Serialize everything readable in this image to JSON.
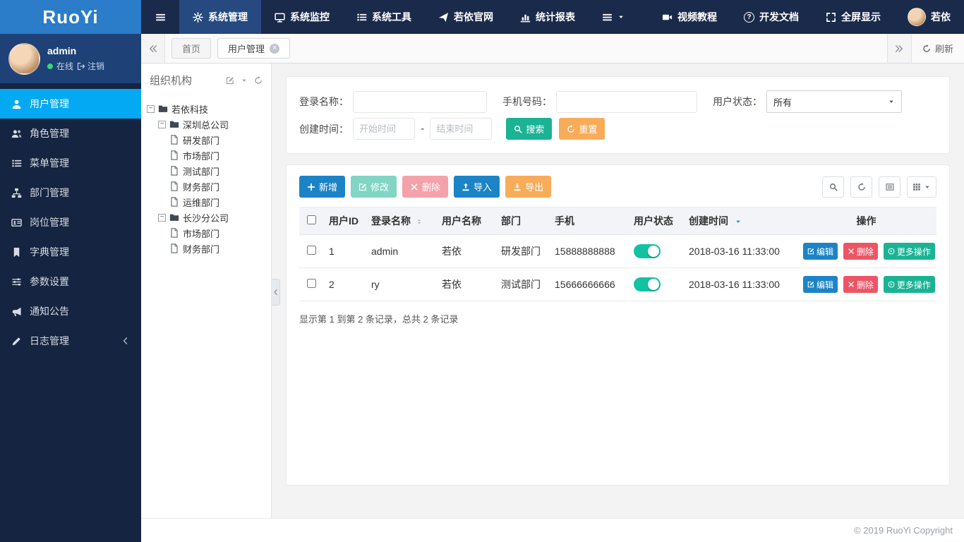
{
  "brand": {
    "logo_text": "RuoYi"
  },
  "topnav": {
    "items": [
      {
        "label": "系统管理",
        "icon": "gear-icon",
        "active": true
      },
      {
        "label": "系统监控",
        "icon": "monitor-icon",
        "active": false
      },
      {
        "label": "系统工具",
        "icon": "list-icon",
        "active": false
      },
      {
        "label": "若依官网",
        "icon": "send-icon",
        "active": false
      },
      {
        "label": "统计报表",
        "icon": "bar-chart-icon",
        "active": false
      }
    ],
    "right_items": [
      {
        "label": "视频教程",
        "icon": "video-icon"
      },
      {
        "label": "开发文档",
        "icon": "question-circle-icon"
      },
      {
        "label": "全屏显示",
        "icon": "expand-icon"
      }
    ],
    "user_name": "若依"
  },
  "sidebar": {
    "user": {
      "name": "admin",
      "status": "在线",
      "logout_label": "注销"
    },
    "items": [
      {
        "label": "用户管理",
        "icon": "user-icon",
        "active": true
      },
      {
        "label": "角色管理",
        "icon": "users-icon",
        "active": false
      },
      {
        "label": "菜单管理",
        "icon": "menu-list-icon",
        "active": false
      },
      {
        "label": "部门管理",
        "icon": "sitemap-icon",
        "active": false
      },
      {
        "label": "岗位管理",
        "icon": "id-card-icon",
        "active": false
      },
      {
        "label": "字典管理",
        "icon": "bookmark-icon",
        "active": false
      },
      {
        "label": "参数设置",
        "icon": "sliders-icon",
        "active": false
      },
      {
        "label": "通知公告",
        "icon": "bullhorn-icon",
        "active": false
      },
      {
        "label": "日志管理",
        "icon": "pencil-icon",
        "active": false,
        "has_submenu": true
      }
    ]
  },
  "tabbar": {
    "tabs": [
      {
        "label": "首页",
        "active": false,
        "closable": false
      },
      {
        "label": "用户管理",
        "active": true,
        "closable": true
      }
    ],
    "refresh_label": "刷新"
  },
  "org_panel": {
    "title": "组织机构",
    "tree": [
      {
        "label": "若依科技",
        "depth": 0,
        "type": "folder",
        "expanded": true
      },
      {
        "label": "深圳总公司",
        "depth": 1,
        "type": "folder",
        "expanded": true
      },
      {
        "label": "研发部门",
        "depth": 2,
        "type": "file"
      },
      {
        "label": "市场部门",
        "depth": 2,
        "type": "file"
      },
      {
        "label": "测试部门",
        "depth": 2,
        "type": "file"
      },
      {
        "label": "财务部门",
        "depth": 2,
        "type": "file"
      },
      {
        "label": "运维部门",
        "depth": 2,
        "type": "file"
      },
      {
        "label": "长沙分公司",
        "depth": 1,
        "type": "folder",
        "expanded": true
      },
      {
        "label": "市场部门",
        "depth": 2,
        "type": "file"
      },
      {
        "label": "财务部门",
        "depth": 2,
        "type": "file"
      }
    ]
  },
  "search": {
    "login_name_label": "登录名称：",
    "login_name_value": "",
    "phone_label": "手机号码：",
    "phone_value": "",
    "status_label": "用户状态：",
    "status_value": "所有",
    "create_time_label": "创建时间：",
    "start_placeholder": "开始时间",
    "end_placeholder": "结束时间",
    "range_separator": "-",
    "search_button": "搜索",
    "reset_button": "重置"
  },
  "toolbar": {
    "add": "新增",
    "edit": "修改",
    "delete": "删除",
    "import": "导入",
    "export": "导出"
  },
  "table": {
    "headers": [
      {
        "label": "用户ID",
        "sortable": false
      },
      {
        "label": "登录名称",
        "sortable": true
      },
      {
        "label": "用户名称",
        "sortable": false
      },
      {
        "label": "部门",
        "sortable": false
      },
      {
        "label": "手机",
        "sortable": false
      },
      {
        "label": "用户状态",
        "sortable": false
      },
      {
        "label": "创建时间",
        "sortable": true,
        "sort": "desc"
      },
      {
        "label": "操作",
        "sortable": false
      }
    ],
    "rows": [
      {
        "id": "1",
        "login": "admin",
        "name": "若依",
        "dept": "研发部门",
        "phone": "15888888888",
        "status_on": true,
        "created": "2018-03-16 11:33:00"
      },
      {
        "id": "2",
        "login": "ry",
        "name": "若依",
        "dept": "测试部门",
        "phone": "15666666666",
        "status_on": true,
        "created": "2018-03-16 11:33:00"
      }
    ],
    "row_actions": {
      "edit": "编辑",
      "delete": "删除",
      "more": "更多操作"
    },
    "summary": "显示第 1 到第 2 条记录，总共 2 条记录"
  },
  "footer": {
    "copyright": "© 2019 RuoYi Copyright"
  },
  "colors": {
    "logo_bg": "#2b7cc9",
    "navbar_bg": "#1a2a4a",
    "topnav_active_bg": "#264a80",
    "sidebar_bg": "#152440",
    "user_panel_bg": "#1e4277",
    "sidebar_active_bg": "#03a9f3",
    "primary": "#1c84c6",
    "success": "#1ab394",
    "danger": "#ed5565",
    "warning": "#f8ac59",
    "toggle_on": "#13c2a3",
    "sort_active_caret": "#1e88e5"
  }
}
